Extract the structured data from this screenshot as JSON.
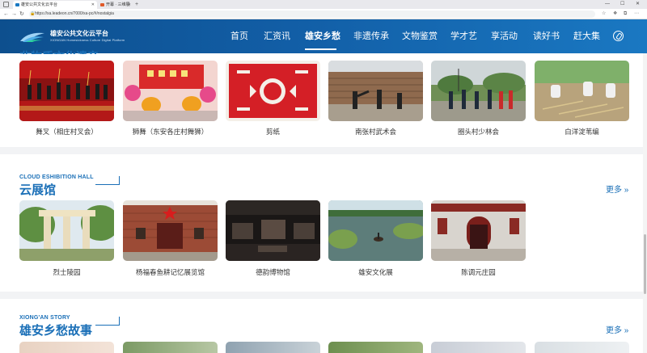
{
  "browser": {
    "tabs": [
      {
        "label": "雄安公共文化云平台",
        "active": true
      },
      {
        "label": "开幕 · 三维展示",
        "active": false
      }
    ],
    "new_tab": "+",
    "window_controls": {
      "minimize": "—",
      "maximize": "☐",
      "close": "✕"
    },
    "url": "https://xa.leadeon.cn/7000/xa-pc/#/nostalgia"
  },
  "site": {
    "title": "雄安公共文化云平台",
    "subtitle": "XIONGAN Homesickness Culture Digital Platform",
    "nav": [
      "首页",
      "汇资讯",
      "雄安乡愁",
      "非遗传承",
      "文物鉴赏",
      "学才艺",
      "享活动",
      "读好书",
      "赶大集"
    ],
    "active_nav": "雄安乡愁"
  },
  "heritage": {
    "heading": "非物质文化遗产",
    "items": [
      {
        "caption": "舞叉（相庄村叉会）"
      },
      {
        "caption": "狮舞（东安各庄村舞狮）"
      },
      {
        "caption": "剪纸"
      },
      {
        "caption": "南张村武术会"
      },
      {
        "caption": "圈头村少林会"
      },
      {
        "caption": "白洋淀苇编"
      }
    ]
  },
  "exhibition": {
    "title_en": "CLOUD ESHIBITION HALL",
    "title_cn": "云展馆",
    "more": "更多 »",
    "items": [
      {
        "caption": "烈士陵园"
      },
      {
        "caption": "杨福春鱼耕记忆展览馆"
      },
      {
        "caption": "德韵博物馆"
      },
      {
        "caption": "雄安文化展"
      },
      {
        "caption": "陈调元庄园"
      }
    ]
  },
  "story": {
    "title_en": "XIONG'AN STORY",
    "title_cn": "雄安乡愁故事",
    "more": "更多 »"
  },
  "colors": {
    "brand": "#1a6fb7",
    "header": "#125ea6",
    "separator": "#f2f3f5"
  }
}
